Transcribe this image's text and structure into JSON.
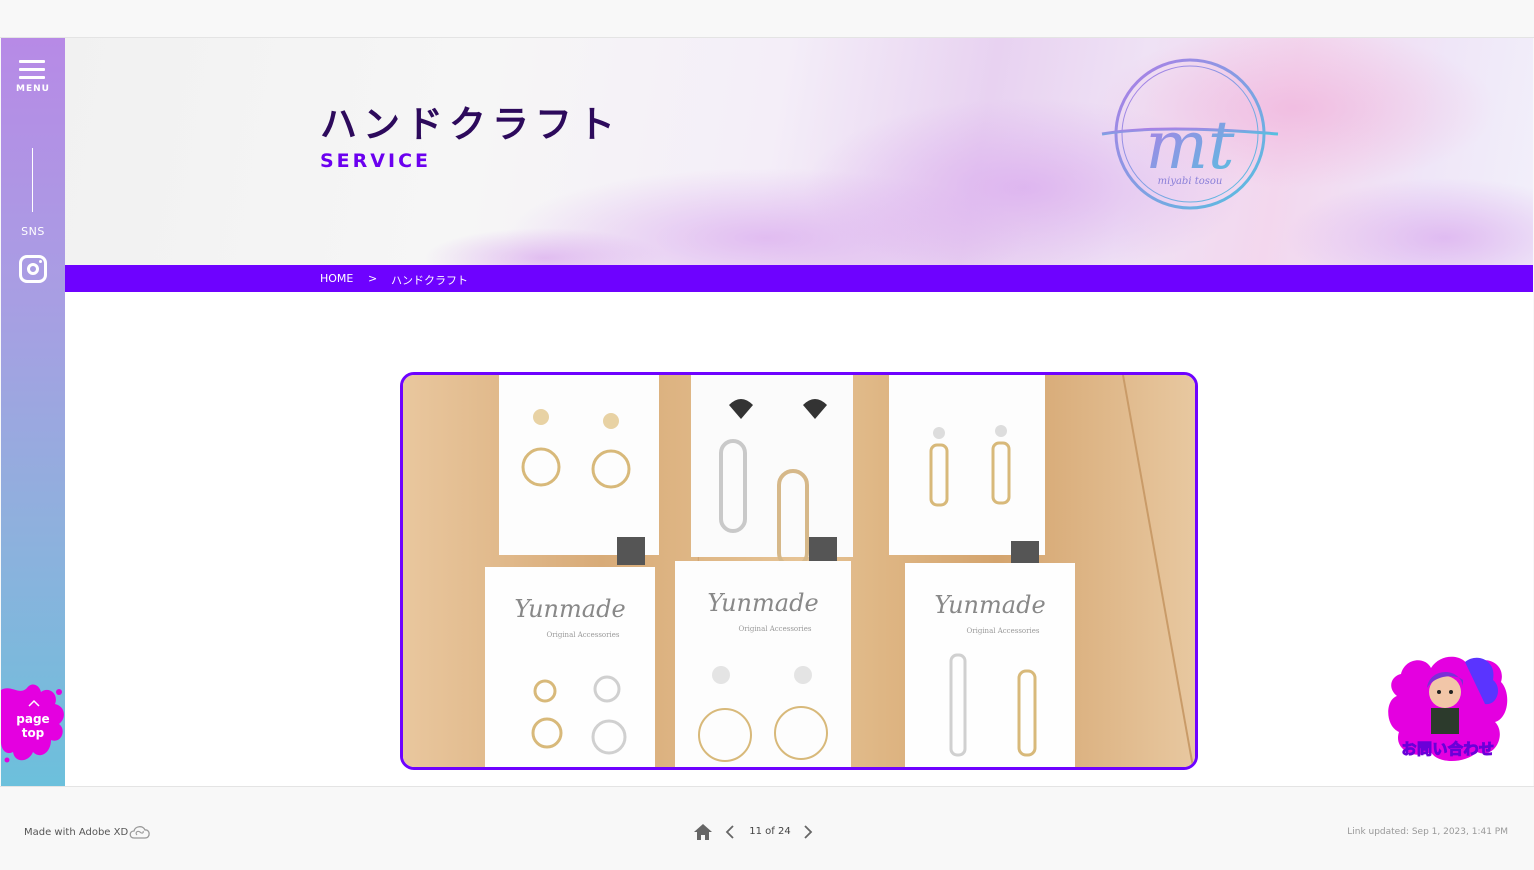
{
  "sidebar": {
    "menu_label": "MENU",
    "sns_label": "SNS",
    "page_top_label_1": "page",
    "page_top_label_2": "top"
  },
  "hero": {
    "title": "ハンドクラフト",
    "subtitle": "SERVICE",
    "logo_letters": "mt",
    "logo_caption": "miyabi tosou"
  },
  "breadcrumb": {
    "home": "HOME",
    "separator": ">",
    "current": "ハンドクラフト"
  },
  "photo": {
    "card_brand": "Yunmade",
    "card_tagline": "Original Accessories"
  },
  "contact": {
    "label": "お問い合わせ"
  },
  "footer": {
    "made_with": "Made with Adobe XD",
    "page_indicator": "11 of 24",
    "link_updated": "Link updated: Sep 1, 2023, 1:41 PM"
  },
  "colors": {
    "accent": "#6e02ff",
    "title": "#2d0a5c",
    "sidebar_top": "#b78ae6",
    "sidebar_bottom": "#6cc0dc"
  }
}
